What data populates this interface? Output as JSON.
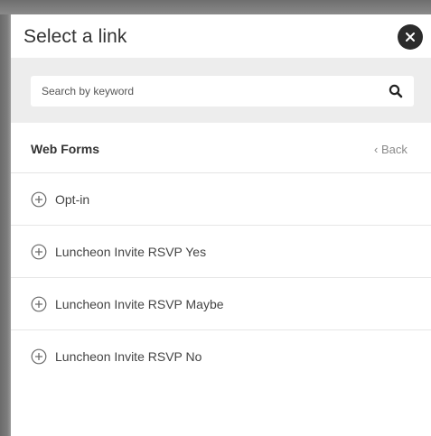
{
  "dialog": {
    "title": "Select a link",
    "close_icon": "close-icon"
  },
  "search": {
    "placeholder": "Search by keyword",
    "value": "",
    "icon": "search-icon"
  },
  "section": {
    "title": "Web Forms",
    "back_label": "‹ Back"
  },
  "items": [
    {
      "label": "Opt-in",
      "icon": "plus-circle-icon"
    },
    {
      "label": "Luncheon Invite RSVP Yes",
      "icon": "plus-circle-icon"
    },
    {
      "label": "Luncheon Invite RSVP Maybe",
      "icon": "plus-circle-icon"
    },
    {
      "label": "Luncheon Invite RSVP No",
      "icon": "plus-circle-icon"
    }
  ],
  "colors": {
    "close_button": "#2b2b2b",
    "search_bar_bg": "#ededed",
    "back_link": "#8a8a8a",
    "text": "#333333"
  }
}
